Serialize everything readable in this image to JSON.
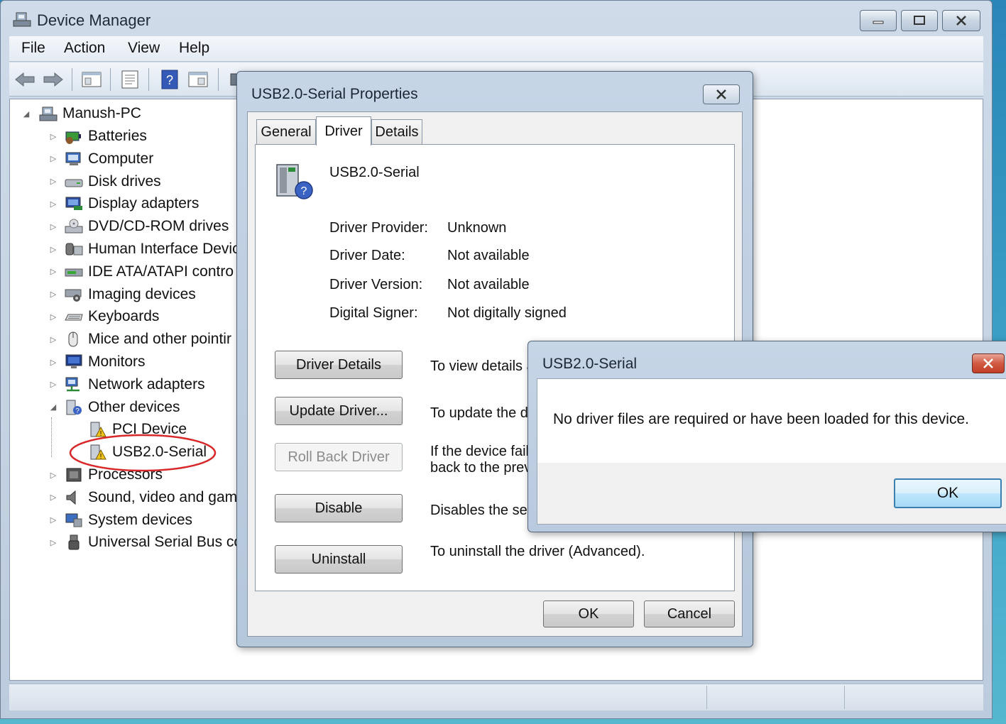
{
  "main_window": {
    "title": "Device Manager",
    "menu": [
      "File",
      "Action",
      "View",
      "Help"
    ]
  },
  "tree": {
    "root": "Manush-PC",
    "categories": [
      {
        "label": "Batteries",
        "icon": "battery-icon"
      },
      {
        "label": "Computer",
        "icon": "computer-icon"
      },
      {
        "label": "Disk drives",
        "icon": "disk-drive-icon"
      },
      {
        "label": "Display adapters",
        "icon": "display-adapter-icon"
      },
      {
        "label": "DVD/CD-ROM drives",
        "icon": "dvd-drive-icon"
      },
      {
        "label": "Human Interface Devic",
        "icon": "hid-icon"
      },
      {
        "label": "IDE ATA/ATAPI contro",
        "icon": "ide-controller-icon"
      },
      {
        "label": "Imaging devices",
        "icon": "camera-icon"
      },
      {
        "label": "Keyboards",
        "icon": "keyboard-icon"
      },
      {
        "label": "Mice and other pointir",
        "icon": "mouse-icon"
      },
      {
        "label": "Monitors",
        "icon": "monitor-icon"
      },
      {
        "label": "Network adapters",
        "icon": "network-icon"
      },
      {
        "label": "Other devices",
        "icon": "unknown-device-icon"
      },
      {
        "label": "PCI Device",
        "icon": "warning-device-icon"
      },
      {
        "label": "USB2.0-Serial",
        "icon": "warning-device-icon"
      },
      {
        "label": "Processors",
        "icon": "processor-icon"
      },
      {
        "label": "Sound, video and gam",
        "icon": "speaker-icon"
      },
      {
        "label": "System devices",
        "icon": "system-icon"
      },
      {
        "label": "Universal Serial Bus co",
        "icon": "usb-icon"
      }
    ]
  },
  "properties": {
    "title": "USB2.0-Serial Properties",
    "tabs": [
      "General",
      "Driver",
      "Details"
    ],
    "active_tab": "Driver",
    "device_name": "USB2.0-Serial",
    "info": [
      {
        "label": "Driver Provider:",
        "value": "Unknown"
      },
      {
        "label": "Driver Date:",
        "value": "Not available"
      },
      {
        "label": "Driver Version:",
        "value": "Not available"
      },
      {
        "label": "Digital Signer:",
        "value": "Not digitally signed"
      }
    ],
    "actions": [
      {
        "button": "Driver Details",
        "desc1": "To view details a",
        "desc2": ""
      },
      {
        "button": "Update Driver...",
        "desc1": "To update the dr",
        "desc2": ""
      },
      {
        "button": "Roll Back Driver",
        "desc1": "If the device fails",
        "desc2": "back to the prev"
      },
      {
        "button": "Disable",
        "desc1": "Disables the sele",
        "desc2": ""
      },
      {
        "button": "Uninstall",
        "desc1": "To uninstall the driver (Advanced).",
        "desc2": ""
      }
    ],
    "ok": "OK",
    "cancel": "Cancel"
  },
  "message_box": {
    "title": "USB2.0-Serial",
    "text": "No driver files are required or have been loaded for this device.",
    "ok": "OK"
  },
  "colors": {
    "highlight_circle": "#d8282a",
    "titlebar": "#c6d5e6",
    "close_red": "#c23e26"
  }
}
